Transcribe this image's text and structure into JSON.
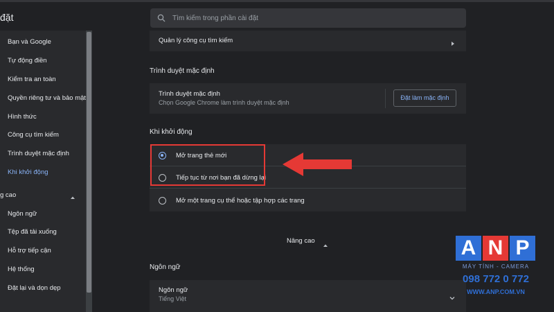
{
  "header": {
    "title": "đặt",
    "search_placeholder": "Tìm kiếm trong phần cài đặt"
  },
  "sidebar": {
    "items": [
      {
        "label": "Bạn và Google"
      },
      {
        "label": "Tự động điền"
      },
      {
        "label": "Kiểm tra an toàn"
      },
      {
        "label": "Quyền riêng tư và bảo mật"
      },
      {
        "label": "Hình thức"
      },
      {
        "label": "Công cụ tìm kiếm"
      },
      {
        "label": "Trình duyệt mặc định"
      },
      {
        "label": "Khi khởi động"
      }
    ],
    "advanced_label": "g cao",
    "advanced_items": [
      {
        "label": "Ngôn ngữ"
      },
      {
        "label": "Tệp đã tải xuống"
      },
      {
        "label": "Hỗ trợ tiếp cận"
      },
      {
        "label": "Hệ thống"
      },
      {
        "label": "Đặt lại và dọn dẹp"
      }
    ]
  },
  "main": {
    "search_engine_row": "Quản lý công cụ tìm kiếm",
    "default_browser": {
      "heading": "Trình duyệt mặc định",
      "title": "Trình duyệt mặc định",
      "subtitle": "Chọn Google Chrome làm trình duyệt mặc định",
      "button": "Đặt làm mặc định"
    },
    "startup": {
      "heading": "Khi khởi động",
      "options": [
        {
          "label": "Mở trang thẻ mới",
          "checked": true
        },
        {
          "label": "Tiếp tục từ nơi bạn đã dừng lại",
          "checked": false
        },
        {
          "label": "Mở một trang cụ thể hoặc tập hợp các trang",
          "checked": false
        }
      ]
    },
    "advanced_label": "Nâng cao",
    "language": {
      "heading": "Ngôn ngữ",
      "title": "Ngôn ngữ",
      "value": "Tiếng Việt"
    }
  },
  "watermark": {
    "letters": [
      "A",
      "N",
      "P"
    ],
    "letter_colors": [
      "#2f6fd6",
      "#e53935",
      "#2f6fd6"
    ],
    "tagline": "MÁY TÍNH - CAMERA",
    "phone": "098 772 0 772",
    "website": "WWW.ANP.COM.VN"
  },
  "colors": {
    "accent": "#8ab4f8",
    "annotation": "#e53935"
  }
}
